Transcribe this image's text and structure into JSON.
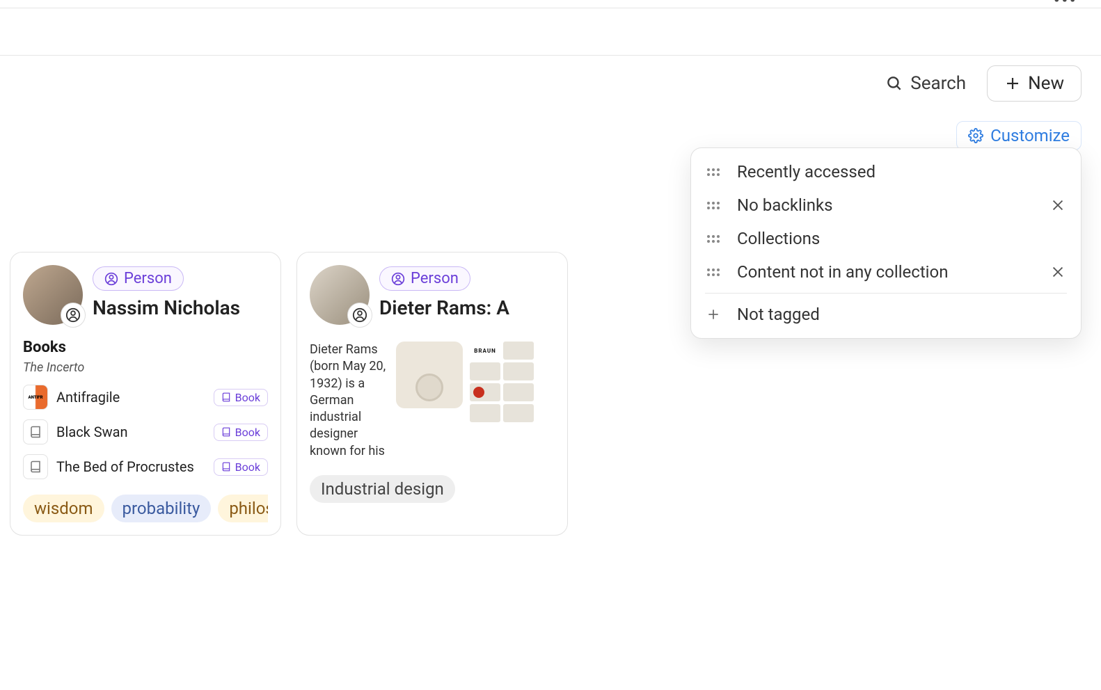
{
  "header": {
    "search_label": "Search",
    "new_label": "New",
    "customize_label": "Customize"
  },
  "dropdown": {
    "items": [
      {
        "label": "Recently accessed",
        "removable": false
      },
      {
        "label": "No backlinks",
        "removable": true
      },
      {
        "label": "Collections",
        "removable": false
      },
      {
        "label": "Content not in any collection",
        "removable": true
      }
    ],
    "add_label": "Not tagged"
  },
  "cards": [
    {
      "type_label": "Person",
      "title": "Nassim Nicholas",
      "section_title": "Books",
      "series": "The Incerto",
      "books": [
        {
          "name": "Antifragile",
          "badge": "Book",
          "icon": "antifragile"
        },
        {
          "name": "Black Swan",
          "badge": "Book",
          "icon": "book"
        },
        {
          "name": "The Bed of Procrustes",
          "badge": "Book",
          "icon": "book"
        }
      ],
      "tags": [
        {
          "text": "wisdom",
          "class": "wisdom"
        },
        {
          "text": "probability",
          "class": "probability"
        },
        {
          "text": "philosoph",
          "class": "philosophy"
        }
      ]
    },
    {
      "type_label": "Person",
      "title": "Dieter Rams: A",
      "bio": "Dieter Rams (born May 20, 1932) is a German industrial designer known for his",
      "brand_label": "BRAUN",
      "tags": [
        {
          "text": "Industrial design",
          "class": "industrial"
        }
      ]
    }
  ]
}
